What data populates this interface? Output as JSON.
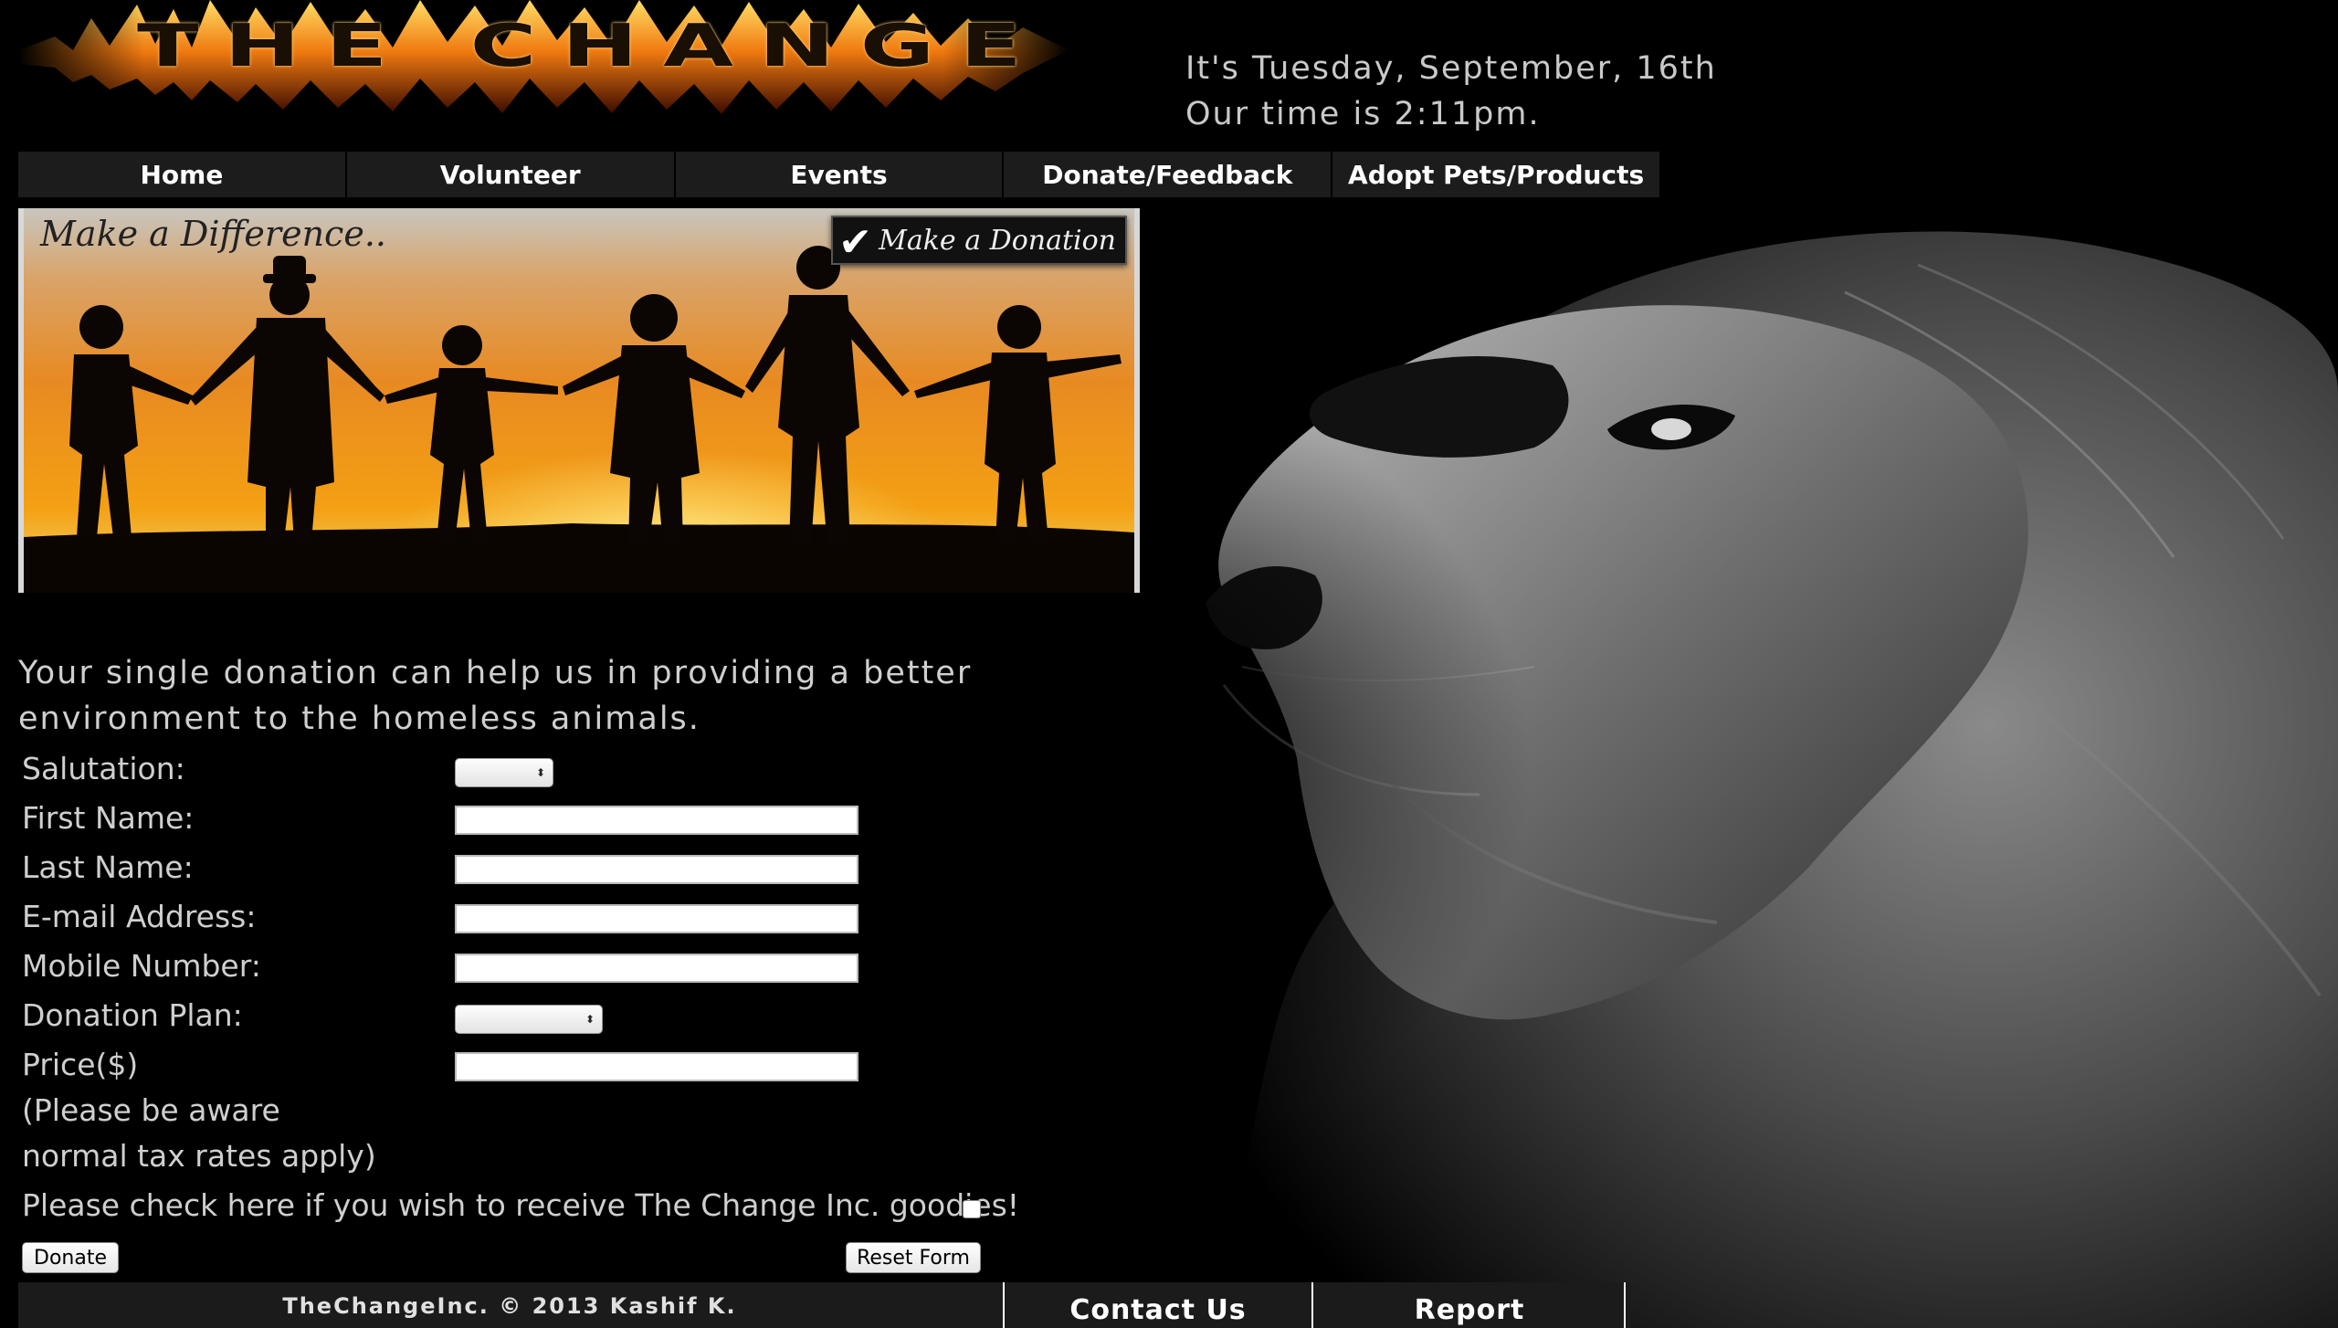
{
  "header": {
    "logo_text": "THE CHANGE",
    "date_line": "It's Tuesday, September, 16th",
    "time_line": "Our time is 2:11pm."
  },
  "nav": {
    "items": [
      {
        "label": "Home"
      },
      {
        "label": "Volunteer"
      },
      {
        "label": "Events"
      },
      {
        "label": "Donate/Feedback"
      },
      {
        "label": "Adopt Pets/Products"
      }
    ]
  },
  "banner": {
    "title": "Make a Difference..",
    "donate_badge": "Make a Donation"
  },
  "intro": {
    "text": "Your single donation can help us in providing a better environment to the homeless animals."
  },
  "form": {
    "salutation_label": "Salutation:",
    "salutation_value": "",
    "first_name_label": "First Name:",
    "first_name_value": "",
    "last_name_label": "Last Name:",
    "last_name_value": "",
    "email_label": "E-mail Address:",
    "email_value": "",
    "mobile_label": "Mobile Number:",
    "mobile_value": "",
    "plan_label": "Donation Plan:",
    "plan_value": "",
    "price_label": "Price($)",
    "price_value": "",
    "tax_note_line1": "(Please be aware",
    "tax_note_line2": "normal tax rates apply)",
    "goodies_label": "Please check here if you wish to receive The Change Inc. goodies!",
    "goodies_checked": false,
    "donate_button": "Donate",
    "reset_button": "Reset Form"
  },
  "footer": {
    "copyright": "TheChangeInc. © 2013 Kashif K.",
    "contact_label": "Contact Us",
    "report_label": "Report"
  },
  "colors": {
    "background": "#000000",
    "nav_bg": "#1c1c1c",
    "sunset_orange": "#f08a1a",
    "text_gray": "#cfcfcf"
  }
}
